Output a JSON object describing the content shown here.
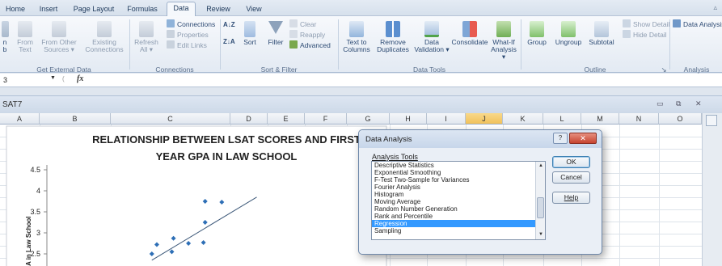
{
  "tabs": [
    "Home",
    "Insert",
    "Page Layout",
    "Formulas",
    "Data",
    "Review",
    "View"
  ],
  "active_tab": "Data",
  "ribbon": {
    "get_external": {
      "label": "Get External Data",
      "buttons": [
        {
          "line1": "n",
          "line2": "b"
        },
        {
          "line1": "From",
          "line2": "Text"
        },
        {
          "line1": "From Other",
          "line2": "Sources ▾"
        },
        {
          "line1": "Existing",
          "line2": "Connections"
        }
      ]
    },
    "connections": {
      "label": "Connections",
      "refresh": {
        "line1": "Refresh",
        "line2": "All ▾"
      },
      "items": [
        "Connections",
        "Properties",
        "Edit Links"
      ]
    },
    "sort_filter": {
      "label": "Sort & Filter",
      "az": "A↓Z",
      "za": "Z↓A",
      "sort": "Sort",
      "filter": "Filter",
      "clear": "Clear",
      "reapply": "Reapply",
      "advanced": "Advanced"
    },
    "data_tools": {
      "label": "Data Tools",
      "buttons": [
        {
          "line1": "Text to",
          "line2": "Columns"
        },
        {
          "line1": "Remove",
          "line2": "Duplicates"
        },
        {
          "line1": "Data",
          "line2": "Validation ▾"
        },
        {
          "line1": "Consolidate",
          "line2": ""
        },
        {
          "line1": "What-If",
          "line2": "Analysis ▾"
        }
      ]
    },
    "outline": {
      "label": "Outline",
      "buttons": [
        "Group",
        "Ungroup",
        "Subtotal"
      ],
      "show_detail": "Show Detail",
      "hide_detail": "Hide Detail"
    },
    "analysis": {
      "label": "Analysis",
      "data_analysis": "Data Analysis"
    }
  },
  "formula_bar": {
    "name_box": "3",
    "fx": "fx"
  },
  "workbook": {
    "name": "SAT7",
    "columns": [
      "A",
      "B",
      "C",
      "D",
      "E",
      "F",
      "G",
      "H",
      "I",
      "J",
      "K",
      "L",
      "M",
      "N",
      "O"
    ],
    "selected_column": "J"
  },
  "chart_data": {
    "type": "scatter",
    "title": "RELATIONSHIP BETWEEN LSAT SCORES AND FIRST YEAR GPA IN LAW SCHOOL",
    "title_line1": "RELATIONSHIP BETWEEN LSAT SCORES AND FIRST",
    "title_line2": "YEAR GPA IN LAW SCHOOL",
    "ylabel": "GPA in Law School",
    "ylabel_visible": "A in Law School",
    "y_ticks": [
      "4.5",
      "4",
      "3.5",
      "3",
      "2.5"
    ],
    "ylim": [
      2.2,
      4.5
    ],
    "xlim": [
      0,
      10
    ],
    "points": [
      {
        "x": 3.15,
        "y": 2.5
      },
      {
        "x": 3.3,
        "y": 2.72
      },
      {
        "x": 3.75,
        "y": 2.55
      },
      {
        "x": 3.8,
        "y": 2.87
      },
      {
        "x": 4.25,
        "y": 2.75
      },
      {
        "x": 4.7,
        "y": 2.77
      },
      {
        "x": 4.75,
        "y": 3.25
      },
      {
        "x": 4.75,
        "y": 3.75
      },
      {
        "x": 5.25,
        "y": 3.73
      }
    ],
    "trendline": {
      "x1": 3.15,
      "y1": 2.35,
      "x2": 6.3,
      "y2": 3.85
    },
    "marker_color": "#2e6fb6",
    "line_color": "#3b5778"
  },
  "dialog": {
    "title": "Data Analysis",
    "help_glyph": "?",
    "close_glyph": "✕",
    "list_label": "Analysis Tools",
    "items": [
      "Descriptive Statistics",
      "Exponential Smoothing",
      "F-Test Two-Sample for Variances",
      "Fourier Analysis",
      "Histogram",
      "Moving Average",
      "Random Number Generation",
      "Rank and Percentile",
      "Regression",
      "Sampling"
    ],
    "selected": "Regression",
    "ok": "OK",
    "cancel": "Cancel",
    "help": "Help"
  }
}
